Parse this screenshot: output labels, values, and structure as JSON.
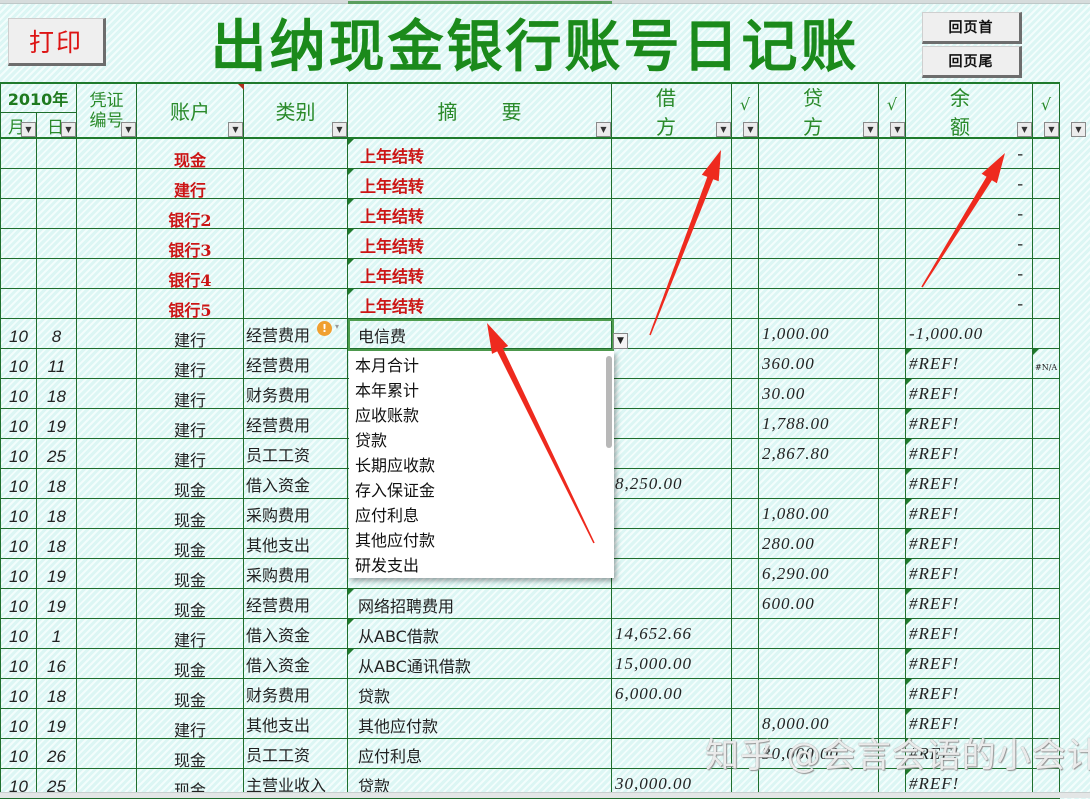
{
  "toolbar": {
    "print_label": "打印",
    "go_top_label": "回页首",
    "go_bottom_label": "回页尾"
  },
  "title": "出纳现金银行账号日记账",
  "header": {
    "year": "2010年",
    "month": "月",
    "day": "日",
    "voucher_line1": "凭证",
    "voucher_line2": "编号",
    "account": "账户",
    "category": "类别",
    "summary": "摘要",
    "debit": "借方",
    "debit_check": "√",
    "credit": "贷方",
    "credit_check": "√",
    "balance": "余额",
    "balance_check": "√"
  },
  "carryover_rows": [
    {
      "account": "现金",
      "summary": "上年结转",
      "balance": "-"
    },
    {
      "account": "建行",
      "summary": "上年结转",
      "balance": "-"
    },
    {
      "account": "银行2",
      "summary": "上年结转",
      "balance": "-"
    },
    {
      "account": "银行3",
      "summary": "上年结转",
      "balance": "-"
    },
    {
      "account": "银行4",
      "summary": "上年结转",
      "balance": "-"
    },
    {
      "account": "银行5",
      "summary": "上年结转",
      "balance": "-"
    }
  ],
  "rows": [
    {
      "month": "10",
      "day": "8",
      "voucher": "",
      "account": "建行",
      "category": "经营费用",
      "summary": "电信费",
      "debit": "",
      "debit_check": "",
      "credit": "1,000.00",
      "credit_check": "",
      "balance": "-1,000.00",
      "balance_check": ""
    },
    {
      "month": "10",
      "day": "11",
      "voucher": "",
      "account": "建行",
      "category": "经营费用",
      "summary": "",
      "debit": "",
      "debit_check": "",
      "credit": "360.00",
      "credit_check": "",
      "balance": "#REF!",
      "balance_check": "#N/A"
    },
    {
      "month": "10",
      "day": "18",
      "voucher": "",
      "account": "建行",
      "category": "财务费用",
      "summary": "",
      "debit": "",
      "debit_check": "",
      "credit": "30.00",
      "credit_check": "",
      "balance": "#REF!",
      "balance_check": ""
    },
    {
      "month": "10",
      "day": "19",
      "voucher": "",
      "account": "建行",
      "category": "经营费用",
      "summary": "",
      "debit": "",
      "debit_check": "",
      "credit": "1,788.00",
      "credit_check": "",
      "balance": "#REF!",
      "balance_check": ""
    },
    {
      "month": "10",
      "day": "25",
      "voucher": "",
      "account": "建行",
      "category": "员工工资",
      "summary": "",
      "debit": "",
      "debit_check": "",
      "credit": "2,867.80",
      "credit_check": "",
      "balance": "#REF!",
      "balance_check": ""
    },
    {
      "month": "10",
      "day": "18",
      "voucher": "",
      "account": "现金",
      "category": "借入资金",
      "summary": "",
      "debit": "8,250.00",
      "debit_check": "",
      "credit": "",
      "credit_check": "",
      "balance": "#REF!",
      "balance_check": ""
    },
    {
      "month": "10",
      "day": "18",
      "voucher": "",
      "account": "现金",
      "category": "采购费用",
      "summary": "",
      "debit": "",
      "debit_check": "",
      "credit": "1,080.00",
      "credit_check": "",
      "balance": "#REF!",
      "balance_check": ""
    },
    {
      "month": "10",
      "day": "18",
      "voucher": "",
      "account": "现金",
      "category": "其他支出",
      "summary": "",
      "debit": "",
      "debit_check": "",
      "credit": "280.00",
      "credit_check": "",
      "balance": "#REF!",
      "balance_check": ""
    },
    {
      "month": "10",
      "day": "19",
      "voucher": "",
      "account": "现金",
      "category": "采购费用",
      "summary": "",
      "debit": "",
      "debit_check": "",
      "credit": "6,290.00",
      "credit_check": "",
      "balance": "#REF!",
      "balance_check": ""
    },
    {
      "month": "10",
      "day": "19",
      "voucher": "",
      "account": "现金",
      "category": "经营费用",
      "summary": "网络招聘费用",
      "debit": "",
      "debit_check": "",
      "credit": "600.00",
      "credit_check": "",
      "balance": "#REF!",
      "balance_check": ""
    },
    {
      "month": "10",
      "day": "1",
      "voucher": "",
      "account": "建行",
      "category": "借入资金",
      "summary": "从ABC借款",
      "debit": "14,652.66",
      "debit_check": "",
      "credit": "",
      "credit_check": "",
      "balance": "#REF!",
      "balance_check": ""
    },
    {
      "month": "10",
      "day": "16",
      "voucher": "",
      "account": "现金",
      "category": "借入资金",
      "summary": "从ABC通讯借款",
      "debit": "15,000.00",
      "debit_check": "",
      "credit": "",
      "credit_check": "",
      "balance": "#REF!",
      "balance_check": ""
    },
    {
      "month": "10",
      "day": "18",
      "voucher": "",
      "account": "现金",
      "category": "财务费用",
      "summary": "贷款",
      "debit": "6,000.00",
      "debit_check": "",
      "credit": "",
      "credit_check": "",
      "balance": "#REF!",
      "balance_check": ""
    },
    {
      "month": "10",
      "day": "19",
      "voucher": "",
      "account": "建行",
      "category": "其他支出",
      "summary": "其他应付款",
      "debit": "",
      "debit_check": "",
      "credit": "8,000.00",
      "credit_check": "",
      "balance": "#REF!",
      "balance_check": ""
    },
    {
      "month": "10",
      "day": "26",
      "voucher": "",
      "account": "现金",
      "category": "员工工资",
      "summary": "应付利息",
      "debit": "",
      "debit_check": "",
      "credit": "30,000.00",
      "credit_check": "",
      "balance": "#REF!",
      "balance_check": ""
    },
    {
      "month": "10",
      "day": "25",
      "voucher": "",
      "account": "现金",
      "category": "主营业收入",
      "summary": "贷款",
      "debit": "30,000.00",
      "debit_check": "",
      "credit": "",
      "credit_check": "",
      "balance": "#REF!",
      "balance_check": ""
    }
  ],
  "active_cell_value": "电信费",
  "dropdown": {
    "options": [
      "本月合计",
      "本年累计",
      "应收账款",
      "贷款",
      "长期应收款",
      "存入保证金",
      "应付利息",
      "其他应付款",
      "研发支出"
    ]
  },
  "icons": {
    "warning": "!",
    "dropdown_arrow": "▼",
    "small_arrow": "▾"
  },
  "watermark": "知乎 @会言会语的小会计",
  "colors": {
    "grid": "#1f6e2c",
    "title": "#1b8a1b",
    "header_text": "#2a8a2a",
    "carryover_text": "#cc1515",
    "print_text": "#dd1414",
    "annotation_arrow": "#ee2a1e"
  }
}
